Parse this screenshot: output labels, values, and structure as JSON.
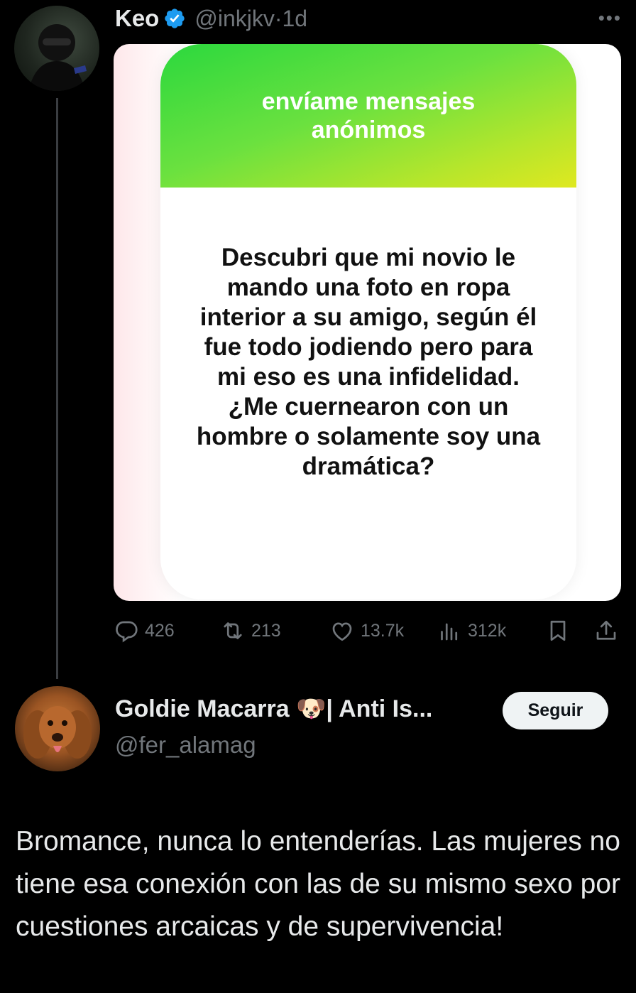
{
  "tweet": {
    "author_name": "Keo",
    "author_handle": "@inkjkv",
    "separator": "·",
    "time_ago": "1d",
    "verified": true,
    "more_icon": "more-dots-icon",
    "media": {
      "header_text": "envíame mensajes anónimos",
      "question_text": "Descubri que mi novio le mando una foto en ropa interior a su amigo, según él fue todo jodiendo pero para mi eso es una infidelidad. ¿Me cuernearon con un hombre o solamente soy una dramática?",
      "header_gradient": [
        "#2bd83e",
        "#dfe820"
      ]
    },
    "actions": {
      "replies": "426",
      "retweets": "213",
      "likes": "13.7k",
      "views": "312k"
    }
  },
  "reply": {
    "author_name": "Goldie Macarra 🐶| Anti Is...",
    "author_handle": "@fer_alamag",
    "follow_label": "Seguir",
    "text": "Bromance, nunca lo entenderías. Las mujeres no tiene esa conexión con las de su mismo sexo por cuestiones arcaicas y de supervivencia!"
  },
  "colors": {
    "background": "#000000",
    "text_primary": "#e7e9ea",
    "text_secondary": "#71767b",
    "verified_blue": "#1d9bf0"
  }
}
